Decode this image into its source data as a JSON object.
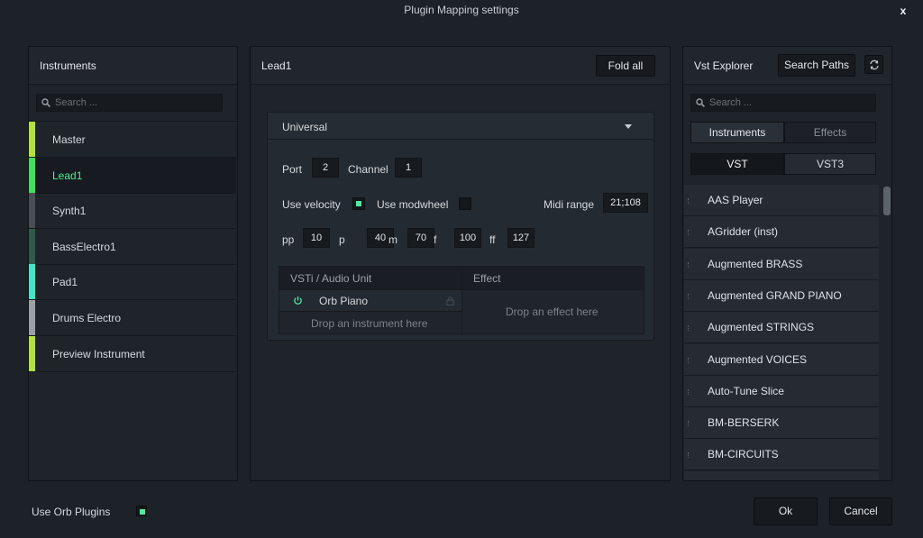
{
  "window": {
    "title": "Plugin Mapping settings",
    "close_label": "x"
  },
  "instruments": {
    "title": "Instruments",
    "search_placeholder": "Search ...",
    "items": [
      {
        "label": "Master",
        "color": "#b4e23a"
      },
      {
        "label": "Lead1",
        "color": "#3fe05c"
      },
      {
        "label": "Synth1",
        "color": "#4a4f55"
      },
      {
        "label": "BassElectro1",
        "color": "#2f5a4c"
      },
      {
        "label": "Pad1",
        "color": "#3fe8c8"
      },
      {
        "label": "Drums Electro",
        "color": "#9ca1a6"
      },
      {
        "label": "Preview Instrument",
        "color": "#b4e23a"
      }
    ]
  },
  "middle": {
    "title": "Lead1",
    "fold_all_label": "Fold all",
    "section": {
      "title": "Universal",
      "port_label": "Port",
      "port_value": "2",
      "channel_label": "Channel",
      "channel_value": "1",
      "use_velocity_label": "Use velocity",
      "use_modwheel_label": "Use modwheel",
      "midi_range_label": "Midi range",
      "midi_range_value": "21;108",
      "dynamics": [
        {
          "label": "pp",
          "value": "10"
        },
        {
          "label": "p",
          "value": "40"
        },
        {
          "label": "m",
          "value": "70"
        },
        {
          "label": "f",
          "value": "100"
        },
        {
          "label": "ff",
          "value": "127"
        }
      ],
      "table": {
        "col_instrument": "VSTi / Audio Unit",
        "col_effect": "Effect",
        "instrument_name": "Orb Piano",
        "drop_instrument": "Drop an instrument here",
        "drop_effect": "Drop an effect here"
      }
    }
  },
  "vst": {
    "title": "Vst Explorer",
    "search_paths_label": "Search Paths",
    "search_placeholder": "Search ...",
    "tab_instruments": "Instruments",
    "tab_effects": "Effects",
    "fmt_vst": "VST",
    "fmt_vst3": "VST3",
    "items": [
      "AAS Player",
      "AGridder (inst)",
      "Augmented BRASS",
      "Augmented GRAND PIANO",
      "Augmented STRINGS",
      "Augmented VOICES",
      "Auto-Tune Slice",
      "BM-BERSERK",
      "BM-CIRCUITS"
    ]
  },
  "footer": {
    "use_orb_label": "Use Orb Plugins",
    "ok_label": "Ok",
    "cancel_label": "Cancel"
  },
  "colors": {
    "accent": "#4cf08a",
    "check": "#52e8a4"
  }
}
